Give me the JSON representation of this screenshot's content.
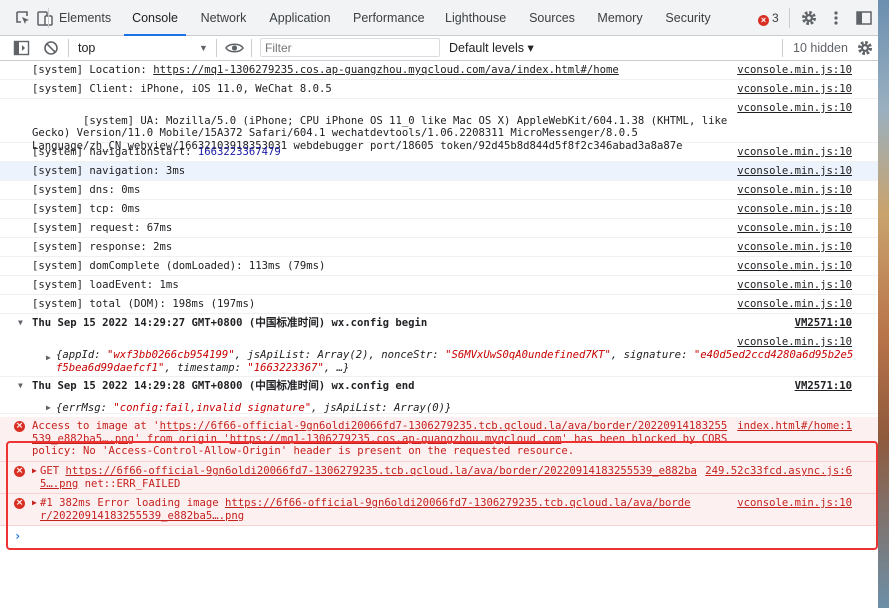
{
  "tabs": [
    {
      "label": "Elements"
    },
    {
      "label": "Console"
    },
    {
      "label": "Network"
    },
    {
      "label": "Application"
    },
    {
      "label": "Performance"
    },
    {
      "label": "Lighthouse"
    },
    {
      "label": "Sources"
    },
    {
      "label": "Memory"
    },
    {
      "label": "Security"
    }
  ],
  "error_count": "3",
  "toolbar": {
    "context": "top",
    "filter_placeholder": "Filter",
    "levels": "Default levels ▾",
    "hidden": "10 hidden"
  },
  "colors": {
    "accent": "#1a73e8",
    "error": "#d93025",
    "highlight": "#edf3fc",
    "annotation": "#ee3333"
  },
  "logs": [
    {
      "text": "[system] Location: ",
      "link": "https://mq1-1306279235.cos.ap-guangzhou.myqcloud.com/ava/index.html#/home",
      "src": "vconsole.min.js:10"
    },
    {
      "text": "[system] Client: iPhone, iOS 11.0, WeChat 8.0.5",
      "src": "vconsole.min.js:10"
    },
    {
      "text": "[system] UA: Mozilla/5.0 (iPhone; CPU iPhone OS 11_0 like Mac OS X) AppleWebKit/604.1.38 (KHTML, like Gecko) Version/11.0 Mobile/15A372 Safari/604.1 wechatdevtools/1.06.2208311 MicroMessenger/8.0.5 Language/zh_CN webview/16632103918353031 webdebugger port/18605 token/92d45b8d844d5f8f2c346abad3a8a87e",
      "src": "vconsole.min.js:10"
    },
    {
      "text": "[system] navigationStart: ",
      "num": "1663223367479",
      "src": "vconsole.min.js:10"
    },
    {
      "text": "[system] navigation: 3ms",
      "src": "vconsole.min.js:10"
    },
    {
      "text": "[system] dns: 0ms",
      "src": "vconsole.min.js:10"
    },
    {
      "text": "[system] tcp: 0ms",
      "src": "vconsole.min.js:10"
    },
    {
      "text": "[system] request: 67ms",
      "src": "vconsole.min.js:10"
    },
    {
      "text": "[system] response: 2ms",
      "src": "vconsole.min.js:10"
    },
    {
      "text": "[system] domComplete (domLoaded): 113ms (79ms)",
      "src": "vconsole.min.js:10"
    },
    {
      "text": "[system] loadEvent: 1ms",
      "src": "vconsole.min.js:10"
    },
    {
      "text": "[system] total (DOM): 198ms (197ms)",
      "src": "vconsole.min.js:10"
    }
  ],
  "group1": {
    "header": "Thu Sep 15 2022 14:29:27 GMT+0800 (中国标准时间) wx.config begin",
    "src": "VM2571:10",
    "obj_src": "vconsole.min.js:10",
    "obj_prefix": "{appId: ",
    "appId": "\"wxf3bb0266cb954199\"",
    "mid1": ", jsApiList: Array(2), nonceStr: ",
    "nonce": "\"S6MVxUwS0qA0undefined7KT\"",
    "mid2": ", signature: ",
    "sig": "\"e40d5ed2ccd4280a6d95b2e5f5bea6d99daefcf1\"",
    "mid3": ", timestamp: ",
    "ts": "\"1663223367\"",
    "end": ", …}"
  },
  "group2": {
    "header": "Thu Sep 15 2022 14:29:28 GMT+0800 (中国标准时间) wx.config end",
    "src": "VM2571:10",
    "obj_prefix": "{errMsg: ",
    "errmsg": "\"config:fail,invalid signature\"",
    "end": ", jsApiList: Array(0)}"
  },
  "errors": [
    {
      "pre": "Access to image at '",
      "link": "https://6f66-official-9gn6oldi20066fd7-1306279235.tcb.qcloud.la/ava/border/20220914183255539_e882ba5….png",
      "post": "' from origin '",
      "link2": "https://mq1-1306279235.cos.ap-guangzhou.myqcloud.com",
      "post2": "' has been blocked by CORS policy: No 'Access-Control-Allow-Origin' header is present on the requested resource.",
      "src": "index.html#/home:1"
    },
    {
      "pre": "GET ",
      "link": "https://6f66-official-9gn6oldi20066fd7-1306279235.tcb.qcloud.la/ava/border/20220914183255539_e882ba5….png",
      "post": " net::ERR_FAILED",
      "src": "249.52c33fcd.async.js:6"
    },
    {
      "pre": "#1 382ms Error loading image ",
      "link": "https://6f66-official-9gn6oldi20066fd7-1306279235.tcb.qcloud.la/ava/border/20220914183255539_e882ba5….png",
      "post": "",
      "src": "vconsole.min.js:10"
    }
  ],
  "prompt": "›"
}
